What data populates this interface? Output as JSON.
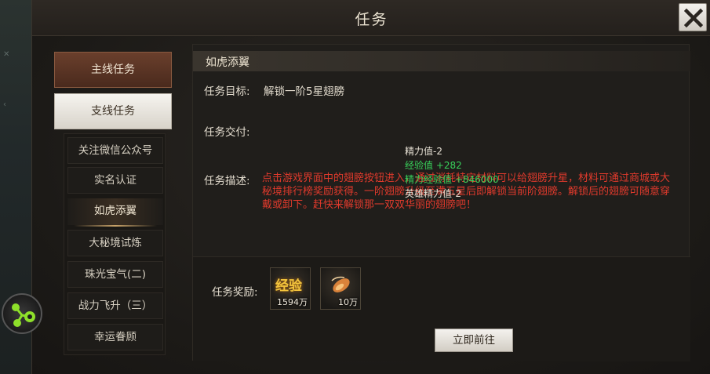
{
  "window": {
    "title": "任务"
  },
  "nav": {
    "main_label": "主线任务",
    "branch_label": "支线任务",
    "sub_items": [
      {
        "label": "关注微信公众号",
        "active": false
      },
      {
        "label": "实名认证",
        "active": false
      },
      {
        "label": "如虎添翼",
        "active": true
      },
      {
        "label": "大秘境试炼",
        "active": false
      },
      {
        "label": "珠光宝气(二)",
        "active": false
      },
      {
        "label": "战力飞升（三）",
        "active": false
      },
      {
        "label": "幸运眷顾",
        "active": false
      }
    ]
  },
  "quest": {
    "title": "如虎添翼",
    "goal_label": "任务目标:",
    "goal_value": "解锁一阶5星翅膀",
    "delivery_label": "任务交付:",
    "desc_label": "任务描述:",
    "description": "点击游戏界面中的翅膀按钮进入，通过消耗特定材料可以给翅膀升星，材料可通过商城或大秘境排行榜奖励获得。一阶翅膀升级至满五星后即解锁当前阶翅膀。解锁后的翅膀可随意穿戴或卸下。赶快来解锁那一双双华丽的翅膀吧！",
    "reward_label": "任务奖励:",
    "rewards": [
      {
        "icon": "exp-icon",
        "glyph": "经验",
        "qty": "1594万"
      },
      {
        "icon": "item-icon",
        "qty": "10万"
      }
    ],
    "go_button": "立即前往"
  },
  "floating_text": [
    {
      "text": "精力值-2",
      "color": "#e6e0d4"
    },
    {
      "text": "经验值 +282",
      "color": "#38d05a"
    },
    {
      "text": "精力经验值 +846000",
      "color": "#38d05a"
    },
    {
      "text": "英雄精力值-2",
      "color": "#e6e0d4"
    }
  ],
  "colors": {
    "accent": "#6a3f2c",
    "description": "#e03a2c",
    "gain": "#38d05a"
  }
}
